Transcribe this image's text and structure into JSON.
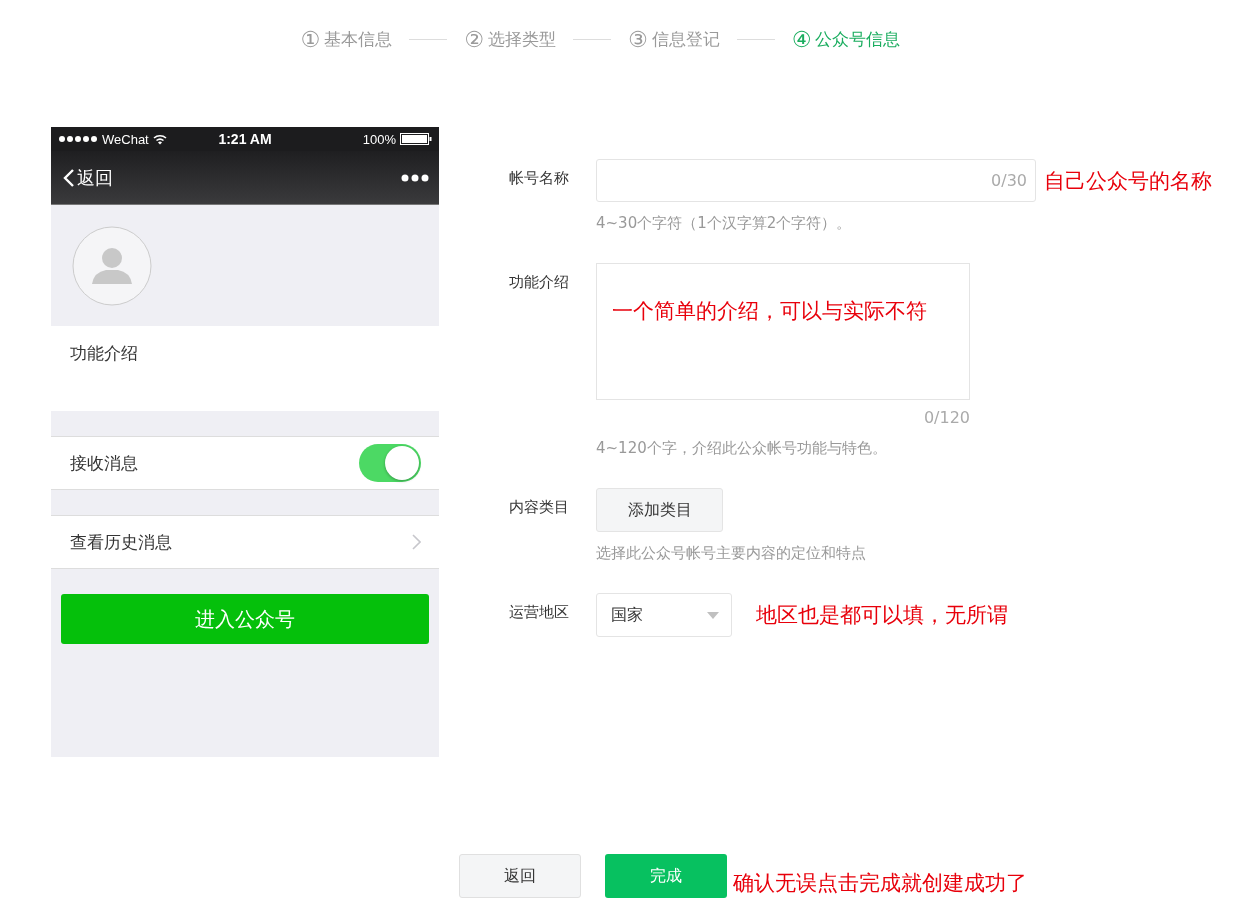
{
  "steps": [
    {
      "number": "①",
      "label": "基本信息",
      "selected": false
    },
    {
      "number": "②",
      "label": "选择类型",
      "selected": false
    },
    {
      "number": "③",
      "label": "信息登记",
      "selected": false
    },
    {
      "number": "④",
      "label": "公众号信息",
      "selected": true
    }
  ],
  "phone_preview": {
    "status_bar": {
      "carrier": "WeChat",
      "time": "1:21 AM",
      "battery": "100%"
    },
    "nav": {
      "back": "返回"
    },
    "intro_label": "功能介绍",
    "rows": [
      {
        "kind": "toggle",
        "label": "接收消息",
        "on": true
      },
      {
        "kind": "link",
        "label": "查看历史消息"
      }
    ],
    "enter_button": "进入公众号"
  },
  "form": {
    "fields": [
      {
        "kind": "input",
        "label": "帐号名称",
        "counter": "0/30",
        "hint": "4~30个字符（1个汉字算2个字符）。",
        "annotation": "自己公众号的名称"
      },
      {
        "kind": "textarea",
        "label": "功能介绍",
        "counter": "0/120",
        "hint": "4~120个字，介绍此公众帐号功能与特色。",
        "annotation": "一个简单的介绍，可以与实际不符"
      },
      {
        "kind": "button",
        "label": "内容类目",
        "button": "添加类目",
        "hint": "选择此公众号帐号主要内容的定位和特点"
      },
      {
        "kind": "select",
        "label": "运营地区",
        "value": "国家",
        "annotation": "地区也是都可以填，无所谓"
      }
    ]
  },
  "footer": {
    "buttons": [
      {
        "kind": "secondary",
        "label": "返回"
      },
      {
        "kind": "primary",
        "label": "完成"
      }
    ],
    "annotation": "确认无误点击完成就创建成功了"
  }
}
